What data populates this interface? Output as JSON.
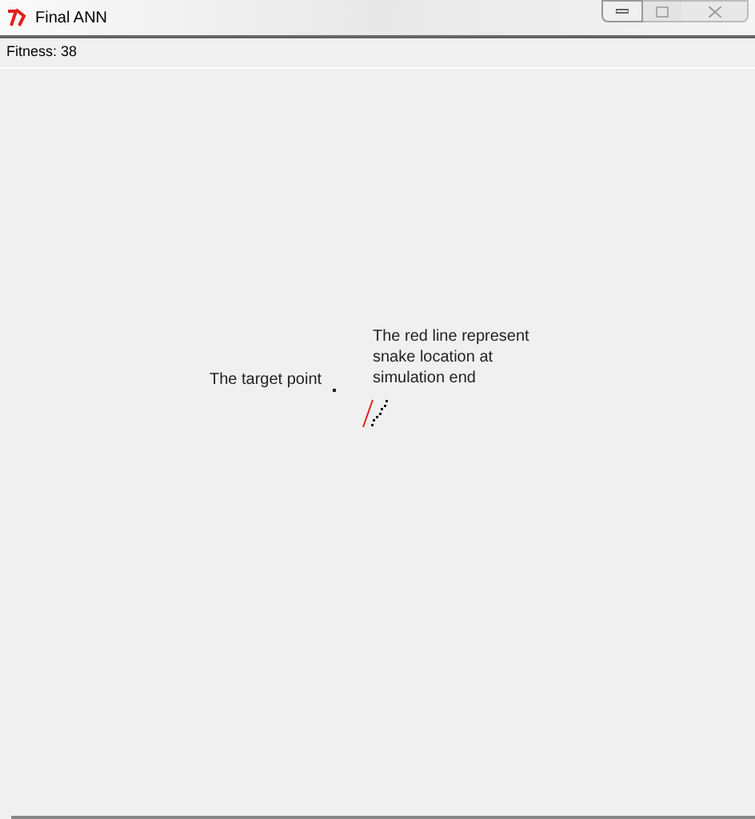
{
  "window": {
    "title": "Final ANN"
  },
  "status": {
    "text": "Fitness: 38"
  },
  "canvas": {
    "annotations": [
      {
        "text": "The target point",
        "kind": "label"
      },
      {
        "text": "The red line represent snake location at simulation end",
        "kind": "note"
      }
    ]
  }
}
